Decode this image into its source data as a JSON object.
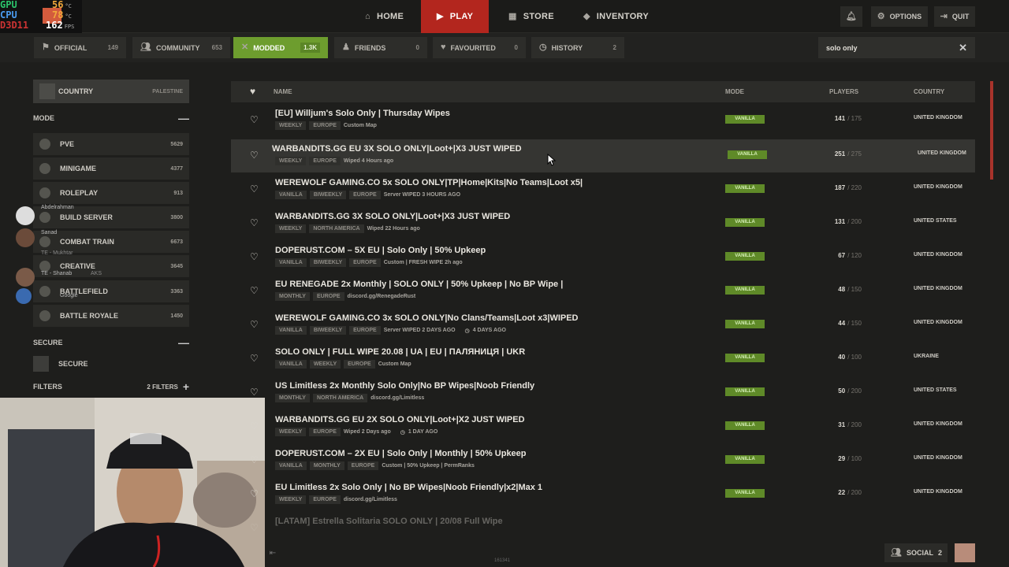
{
  "stats": {
    "gpu_label": "GPU",
    "gpu_value": "56",
    "gpu_unit": "°C",
    "cpu_label": "CPU",
    "cpu_value": "78",
    "cpu_unit": "°C",
    "d3d_label": "D3D11",
    "fps_value": "162",
    "fps_unit": "FPS"
  },
  "nav": {
    "home": "HOME",
    "play": "PLAY",
    "store": "STORE",
    "inventory": "INVENTORY",
    "options": "OPTIONS",
    "quit": "QUIT"
  },
  "filters": [
    {
      "label": "OFFICIAL",
      "count": "149"
    },
    {
      "label": "COMMUNITY",
      "count": "653"
    },
    {
      "label": "MODDED",
      "count": "1.3K"
    },
    {
      "label": "FRIENDS",
      "count": "0"
    },
    {
      "label": "FAVOURITED",
      "count": "0"
    },
    {
      "label": "HISTORY",
      "count": "2"
    }
  ],
  "search": {
    "value": "solo only"
  },
  "sidebar": {
    "country_label": "COUNTRY",
    "country_value": "PALESTINE",
    "mode_header": "MODE",
    "modes": [
      {
        "label": "PVE",
        "count": "5629"
      },
      {
        "label": "MINIGAME",
        "count": "4377"
      },
      {
        "label": "ROLEPLAY",
        "count": "913"
      },
      {
        "label": "BUILD SERVER",
        "count": "3800"
      },
      {
        "label": "COMBAT TRAIN",
        "count": "6673"
      },
      {
        "label": "CREATIVE",
        "count": "3645"
      },
      {
        "label": "BATTLEFIELD",
        "count": "3363"
      },
      {
        "label": "BATTLE ROYALE",
        "count": "1450"
      }
    ],
    "secure_header": "SECURE",
    "secure_label": "SECURE",
    "filters_header": "FILTERS",
    "filters_count": "2 FILTERS"
  },
  "friends_overlay": [
    {
      "name": "Abdelrahman",
      "sub": ""
    },
    {
      "name": "Sanad",
      "sub": "TE - Mukhtar"
    },
    {
      "name": "TE - Shanab",
      "sub": "AKS"
    },
    {
      "name": "Google",
      "sub": ""
    }
  ],
  "table": {
    "headers": {
      "name": "NAME",
      "mode": "MODE",
      "players": "PLAYERS",
      "country": "COUNTRY"
    },
    "rows": [
      {
        "name": "[EU] Willjum's Solo Only | Thursday Wipes",
        "tags": [
          "WEEKLY",
          "EUROPE"
        ],
        "desc": "Custom Map",
        "extra": "",
        "mode": "VANILLA",
        "players": "141",
        "max": "/ 175",
        "country": "UNITED KINGDOM"
      },
      {
        "name": "WARBANDITS.GG EU 3X SOLO ONLY|Loot+|X3 JUST WIPED",
        "tags": [
          "WEEKLY",
          "EUROPE"
        ],
        "desc": "Wiped 4 Hours ago",
        "extra": "",
        "mode": "VANILLA",
        "players": "251",
        "max": "/ 275",
        "country": "UNITED KINGDOM"
      },
      {
        "name": "WEREWOLF GAMING.CO 5x SOLO ONLY|TP|Home|Kits|No Teams|Loot x5|",
        "tags": [
          "VANILLA",
          "BIWEEKLY",
          "EUROPE"
        ],
        "desc": "Server WIPED 3 HOURS AGO",
        "extra": "",
        "mode": "VANILLA",
        "players": "187",
        "max": "/ 220",
        "country": "UNITED KINGDOM"
      },
      {
        "name": "WARBANDITS.GG 3X SOLO ONLY|Loot+|X3 JUST WIPED",
        "tags": [
          "WEEKLY",
          "NORTH AMERICA"
        ],
        "desc": "Wiped 22 Hours ago",
        "extra": "",
        "mode": "VANILLA",
        "players": "131",
        "max": "/ 200",
        "country": "UNITED STATES"
      },
      {
        "name": "DOPERUST.COM – 5X EU | Solo Only | 50% Upkeep",
        "tags": [
          "VANILLA",
          "BIWEEKLY",
          "EUROPE"
        ],
        "desc": "Custom | FRESH WIPE 2h ago",
        "extra": "",
        "mode": "VANILLA",
        "players": "67",
        "max": "/ 120",
        "country": "UNITED KINGDOM"
      },
      {
        "name": "EU RENEGADE 2x Monthly | SOLO ONLY | 50% Upkeep | No BP Wipe |",
        "tags": [
          "MONTHLY",
          "EUROPE"
        ],
        "desc": "discord.gg/RenegadeRust",
        "extra": "",
        "mode": "VANILLA",
        "players": "48",
        "max": "/ 150",
        "country": "UNITED KINGDOM"
      },
      {
        "name": "WEREWOLF GAMING.CO 3x SOLO ONLY|No Clans/Teams|Loot x3|WIPED",
        "tags": [
          "VANILLA",
          "BIWEEKLY",
          "EUROPE"
        ],
        "desc": "Server WIPED 2 DAYS AGO",
        "extra": "4 DAYS AGO",
        "mode": "VANILLA",
        "players": "44",
        "max": "/ 150",
        "country": "UNITED KINGDOM"
      },
      {
        "name": "SOLO ONLY | FULL WIPE 20.08 | UA | EU | ПАЛЯНИЦЯ | UKR",
        "tags": [
          "VANILLA",
          "WEEKLY",
          "EUROPE"
        ],
        "desc": "Custom Map",
        "extra": "",
        "mode": "VANILLA",
        "players": "40",
        "max": "/ 100",
        "country": "UKRAINE"
      },
      {
        "name": "US Limitless 2x Monthly Solo Only|No BP Wipes|Noob Friendly",
        "tags": [
          "MONTHLY",
          "NORTH AMERICA"
        ],
        "desc": "discord.gg/Limitless",
        "extra": "",
        "mode": "VANILLA",
        "players": "50",
        "max": "/ 200",
        "country": "UNITED STATES"
      },
      {
        "name": "WARBANDITS.GG EU 2X SOLO ONLY|Loot+|X2 JUST WIPED",
        "tags": [
          "WEEKLY",
          "EUROPE"
        ],
        "desc": "Wiped 2 Days ago",
        "extra": "1 DAY AGO",
        "mode": "VANILLA",
        "players": "31",
        "max": "/ 200",
        "country": "UNITED KINGDOM"
      },
      {
        "name": "DOPERUST.COM – 2X EU | Solo Only | Monthly | 50% Upkeep",
        "tags": [
          "VANILLA",
          "MONTHLY",
          "EUROPE"
        ],
        "desc": "Custom | 50% Upkeep | PermRanks",
        "extra": "",
        "mode": "VANILLA",
        "players": "29",
        "max": "/ 100",
        "country": "UNITED KINGDOM"
      },
      {
        "name": "EU Limitless 2x Solo Only | No BP Wipes|Noob Friendly|x2|Max 1",
        "tags": [
          "WEEKLY",
          "EUROPE"
        ],
        "desc": "discord.gg/Limitless",
        "extra": "",
        "mode": "VANILLA",
        "players": "22",
        "max": "/ 200",
        "country": "UNITED KINGDOM"
      },
      {
        "name": "[LATAM] Estrella Solitaria SOLO ONLY | 20/08 Full Wipe",
        "tags": [],
        "desc": "",
        "extra": "",
        "mode": "",
        "players": "",
        "max": "",
        "country": ""
      }
    ]
  },
  "bottom": {
    "social_label": "SOCIAL",
    "social_count": "2",
    "footer_number": "161341"
  }
}
